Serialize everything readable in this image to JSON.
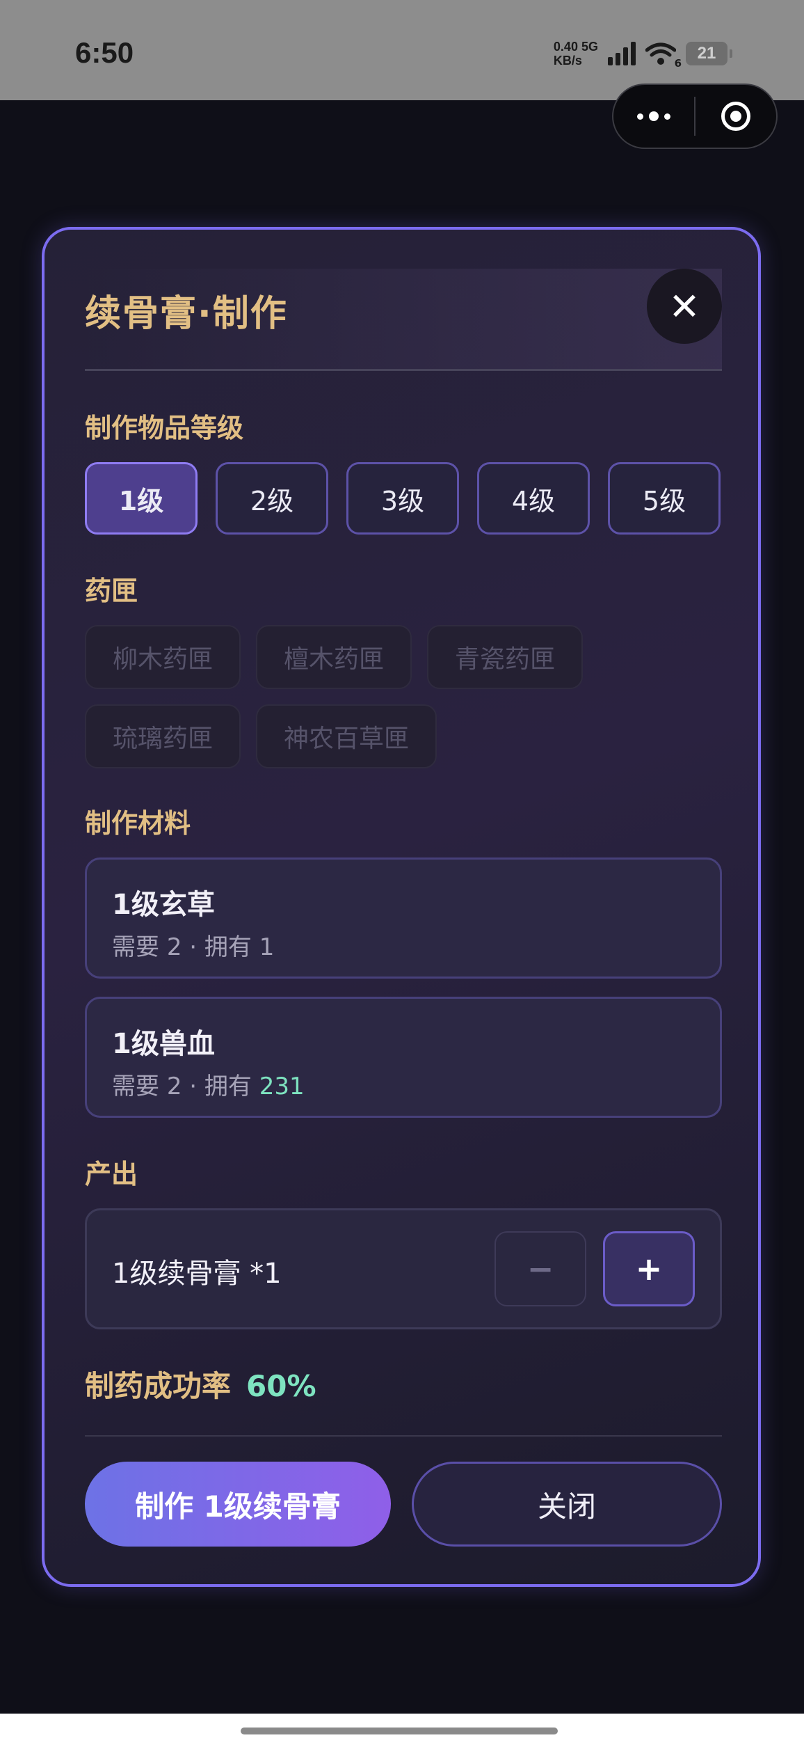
{
  "status_bar": {
    "time": "6:50",
    "net_speed_value": "0.40",
    "net_speed_unit": "KB/s",
    "network": "5G",
    "wifi_sub": "6",
    "battery": "21"
  },
  "capsule": {
    "more_icon": "more-dots-icon",
    "close_icon": "target-icon"
  },
  "modal": {
    "title": "续骨膏·制作",
    "close_symbol": "✕",
    "level_section": {
      "label": "制作物品等级",
      "levels": [
        "1级",
        "2级",
        "3级",
        "4级",
        "5级"
      ],
      "selected_index": 0
    },
    "box_section": {
      "label": "药匣",
      "boxes": [
        "柳木药匣",
        "檀木药匣",
        "青瓷药匣",
        "琉璃药匣",
        "神农百草匣"
      ]
    },
    "materials_section": {
      "label": "制作材料",
      "items": [
        {
          "name": "1级玄草",
          "need_label": "需要",
          "need": "2",
          "sep": "·",
          "have_label": "拥有",
          "have": "1"
        },
        {
          "name": "1级兽血",
          "need_label": "需要",
          "need": "2",
          "sep": "·",
          "have_label": "拥有",
          "have": "231"
        }
      ]
    },
    "output_section": {
      "label": "产出",
      "text": "1级续骨膏 *1",
      "minus": "−",
      "plus": "+"
    },
    "success_rate": {
      "label": "制药成功率",
      "value": "60%"
    },
    "buttons": {
      "make": "制作 1级续骨膏",
      "close": "关闭"
    }
  },
  "colors": {
    "accent_gold": "#e2bf84",
    "accent_green": "#7ee3c0",
    "modal_border": "#7c6cf0",
    "primary_gradient_start": "#6d72e6",
    "primary_gradient_end": "#8f5fe8"
  }
}
